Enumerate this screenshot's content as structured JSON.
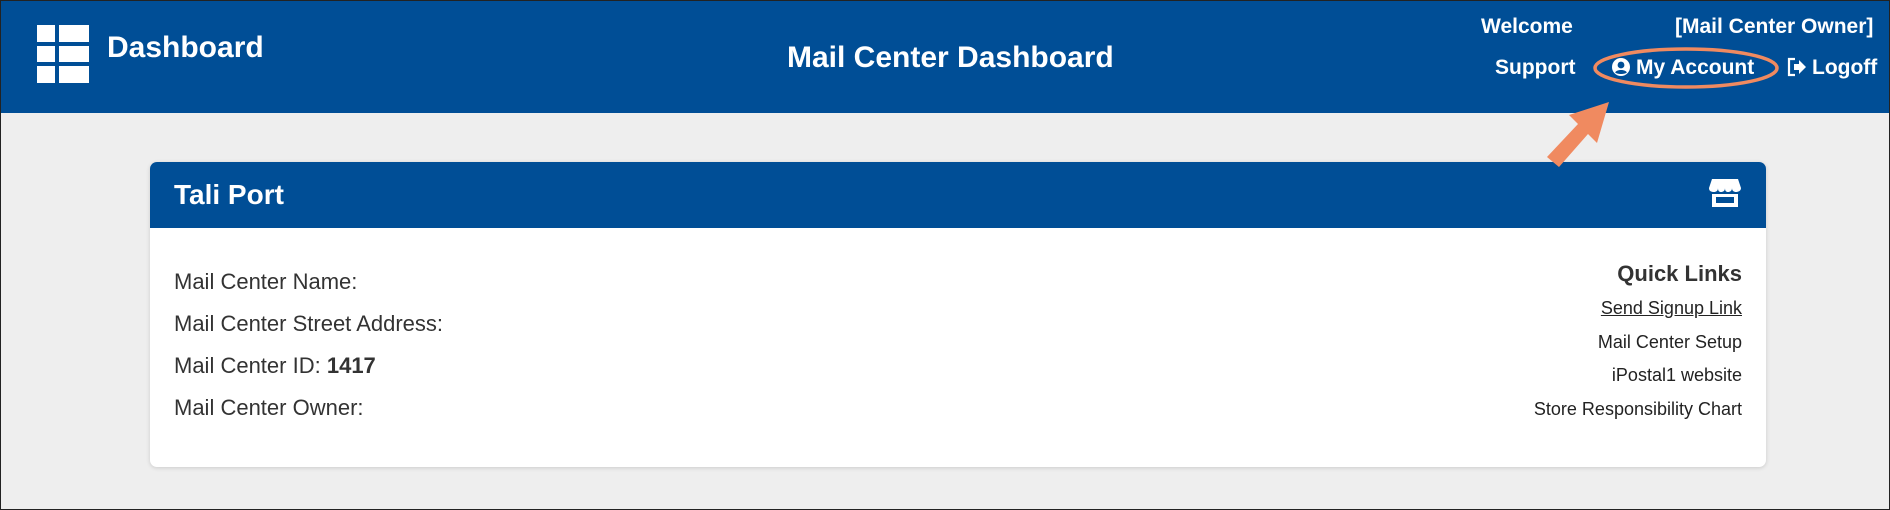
{
  "header": {
    "brand_label": "Dashboard",
    "page_title": "Mail Center Dashboard",
    "welcome_label": "Welcome",
    "owner_label": "[Mail Center Owner]",
    "support_label": "Support",
    "my_account_label": "My Account",
    "logoff_label": "Logoff"
  },
  "card": {
    "title": "Tali Port",
    "mail_center_name_label": "Mail Center Name:",
    "street_address_label": "Mail Center Street Address:",
    "mail_center_id_label": "Mail Center ID:",
    "mail_center_id_value": "1417",
    "owner_label": "Mail Center Owner:"
  },
  "quick_links": {
    "title": "Quick Links",
    "items": [
      {
        "label": "Send Signup Link"
      },
      {
        "label": "Mail Center Setup"
      },
      {
        "label": "iPostal1 website"
      },
      {
        "label": "Store Responsibility Chart"
      }
    ]
  },
  "colors": {
    "primary": "#004e96",
    "background": "#eeeeee",
    "callout": "#f08a60"
  },
  "icons": [
    "grid-icon",
    "user-circle-icon",
    "logout-icon",
    "store-icon",
    "callout-arrow"
  ]
}
